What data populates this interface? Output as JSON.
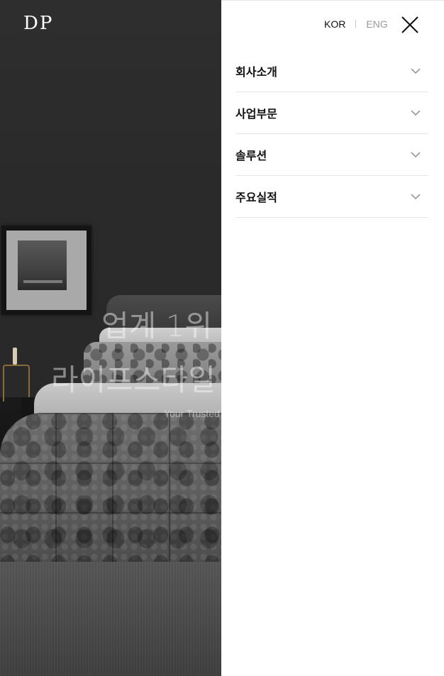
{
  "brand": {
    "logo_text": "DP"
  },
  "hero": {
    "headline_line1": "업계 1위",
    "headline_line2": "라이프스타일",
    "subline": "Your Trusted"
  },
  "language": {
    "kor_label": "KOR",
    "eng_label": "ENG",
    "active": "KOR"
  },
  "menu": {
    "items": [
      {
        "label": "회사소개"
      },
      {
        "label": "사업부문"
      },
      {
        "label": "솔루션"
      },
      {
        "label": "주요실적"
      }
    ],
    "expand_icon": "chevron-down-icon",
    "close_icon": "close-icon"
  },
  "colors": {
    "text_primary": "#111111",
    "text_muted": "#999999",
    "divider": "#e6e6e6",
    "hero_background": "#2a2a2a"
  }
}
